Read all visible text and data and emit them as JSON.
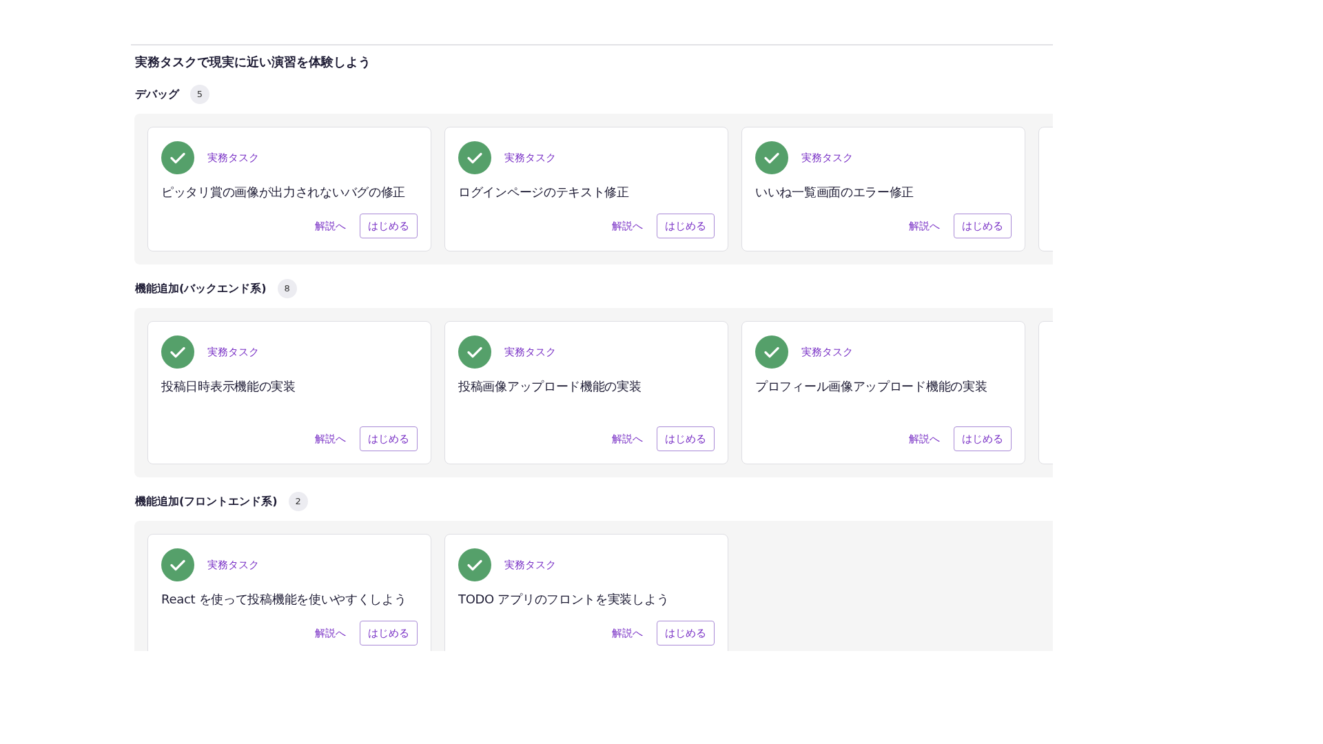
{
  "heading": "実務タスクで現実に近い演習を体験しよう",
  "sections": [
    {
      "title": "デバッグ",
      "count": "5",
      "more_cards": true,
      "cards": [
        {
          "completed": true,
          "label": "実務タスク",
          "title": "ピッタリ賞の画像が出力されないバグの修正",
          "link": "解説へ",
          "button": "はじめる"
        },
        {
          "completed": true,
          "label": "実務タスク",
          "title": "ログインページのテキスト修正",
          "link": "解説へ",
          "button": "はじめる"
        },
        {
          "completed": true,
          "label": "実務タスク",
          "title": "いいね一覧画面のエラー修正",
          "link": "解説へ",
          "button": "はじめる"
        }
      ]
    },
    {
      "title": "機能追加(バックエンド系)",
      "count": "8",
      "more_cards": true,
      "cards": [
        {
          "completed": true,
          "label": "実務タスク",
          "title": "投稿日時表示機能の実装",
          "link": "解説へ",
          "button": "はじめる"
        },
        {
          "completed": true,
          "label": "実務タスク",
          "title": "投稿画像アップロード機能の実装",
          "link": "解説へ",
          "button": "はじめる"
        },
        {
          "completed": true,
          "label": "実務タスク",
          "title": "プロフィール画像アップロード機能の実装",
          "link": "解説へ",
          "button": "はじめる"
        }
      ]
    },
    {
      "title": "機能追加(フロントエンド系)",
      "count": "2",
      "more_cards": false,
      "cards": [
        {
          "completed": true,
          "label": "実務タスク",
          "title": "React を使って投稿機能を使いやすくしよう",
          "link": "解説へ",
          "button": "はじめる"
        },
        {
          "completed": true,
          "label": "実務タスク",
          "title": "TODO アプリのフロントを実装しよう",
          "link": "解説へ",
          "button": "はじめる"
        }
      ]
    }
  ]
}
